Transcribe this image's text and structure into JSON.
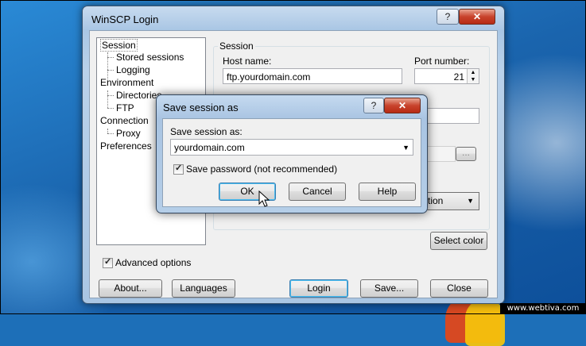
{
  "window": {
    "title": "WinSCP Login",
    "help_btn": "?",
    "close_btn": "✕"
  },
  "tree": {
    "items": [
      {
        "label": "Session"
      },
      {
        "label": "Stored sessions"
      },
      {
        "label": "Logging"
      },
      {
        "label": "Environment"
      },
      {
        "label": "Directories"
      },
      {
        "label": "FTP"
      },
      {
        "label": "Connection"
      },
      {
        "label": "Proxy"
      },
      {
        "label": "Preferences"
      }
    ]
  },
  "session": {
    "group_label": "Session",
    "host_label": "Host name:",
    "host_value": "ftp.yourdomain.com",
    "port_label": "Port number:",
    "port_value": "21",
    "protocol_partial": "tion",
    "browse_label": "..."
  },
  "buttons": {
    "select_color": "Select color",
    "about": "About...",
    "languages": "Languages",
    "login": "Login",
    "save": "Save...",
    "close": "Close"
  },
  "advanced_options": {
    "label": "Advanced options",
    "checked": true
  },
  "dialog": {
    "title": "Save session as",
    "help_btn": "?",
    "close_btn": "✕",
    "field_label": "Save session as:",
    "field_value": "yourdomain.com",
    "save_password_label": "Save password (not recommended)",
    "save_password_checked": true,
    "ok": "OK",
    "cancel": "Cancel",
    "help": "Help"
  },
  "watermark": "www.webtiva.com"
}
